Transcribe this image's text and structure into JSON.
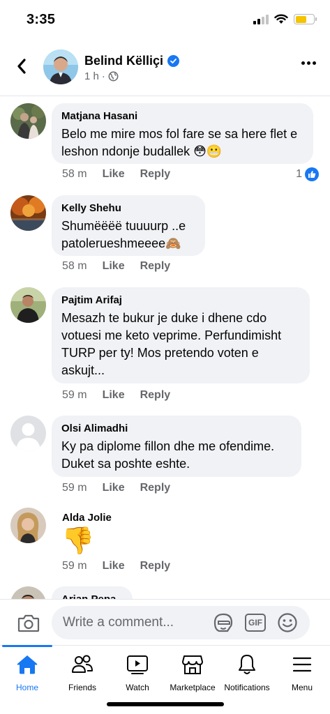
{
  "status_bar": {
    "time": "3:35"
  },
  "post": {
    "author": "Belind Këlliçi",
    "time": "1 h",
    "separator": "·"
  },
  "comments": [
    {
      "author": "Matjana Hasani",
      "text": "Belo me mire mos fol fare se sa here flet e leshon ndonje budallek 😳😬",
      "time": "58 m",
      "like_label": "Like",
      "reply_label": "Reply",
      "like_count": "1"
    },
    {
      "author": "Kelly Shehu",
      "text": "Shumëëëë tuuuurp ..e patoleruеshmeeee🙈",
      "time": "58 m",
      "like_label": "Like",
      "reply_label": "Reply"
    },
    {
      "author": "Pajtim Arifaj",
      "text": "Mesazh te bukur je duke i dhene cdo votuesi me keto veprime. Perfundimisht TURP per ty! Mos pretendo voten e askujt...",
      "time": "59 m",
      "like_label": "Like",
      "reply_label": "Reply"
    },
    {
      "author": "Olsi Alimadhi",
      "text": "Ky pa diplome fillon dhe me ofendime. Duket sa poshte eshte.",
      "time": "59 m",
      "like_label": "Like",
      "reply_label": "Reply"
    },
    {
      "author": "Alda Jolie",
      "text": "👎",
      "time": "59 m",
      "like_label": "Like",
      "reply_label": "Reply"
    },
    {
      "author": "Arian Pepa"
    }
  ],
  "composer": {
    "placeholder": "Write a comment...",
    "gif_label": "GIF"
  },
  "nav": {
    "home": "Home",
    "friends": "Friends",
    "watch": "Watch",
    "marketplace": "Marketplace",
    "notifications": "Notifications",
    "menu": "Menu"
  },
  "colors": {
    "accent": "#1877f2",
    "bubble": "#f0f2f5",
    "secondary_text": "#65676b"
  }
}
